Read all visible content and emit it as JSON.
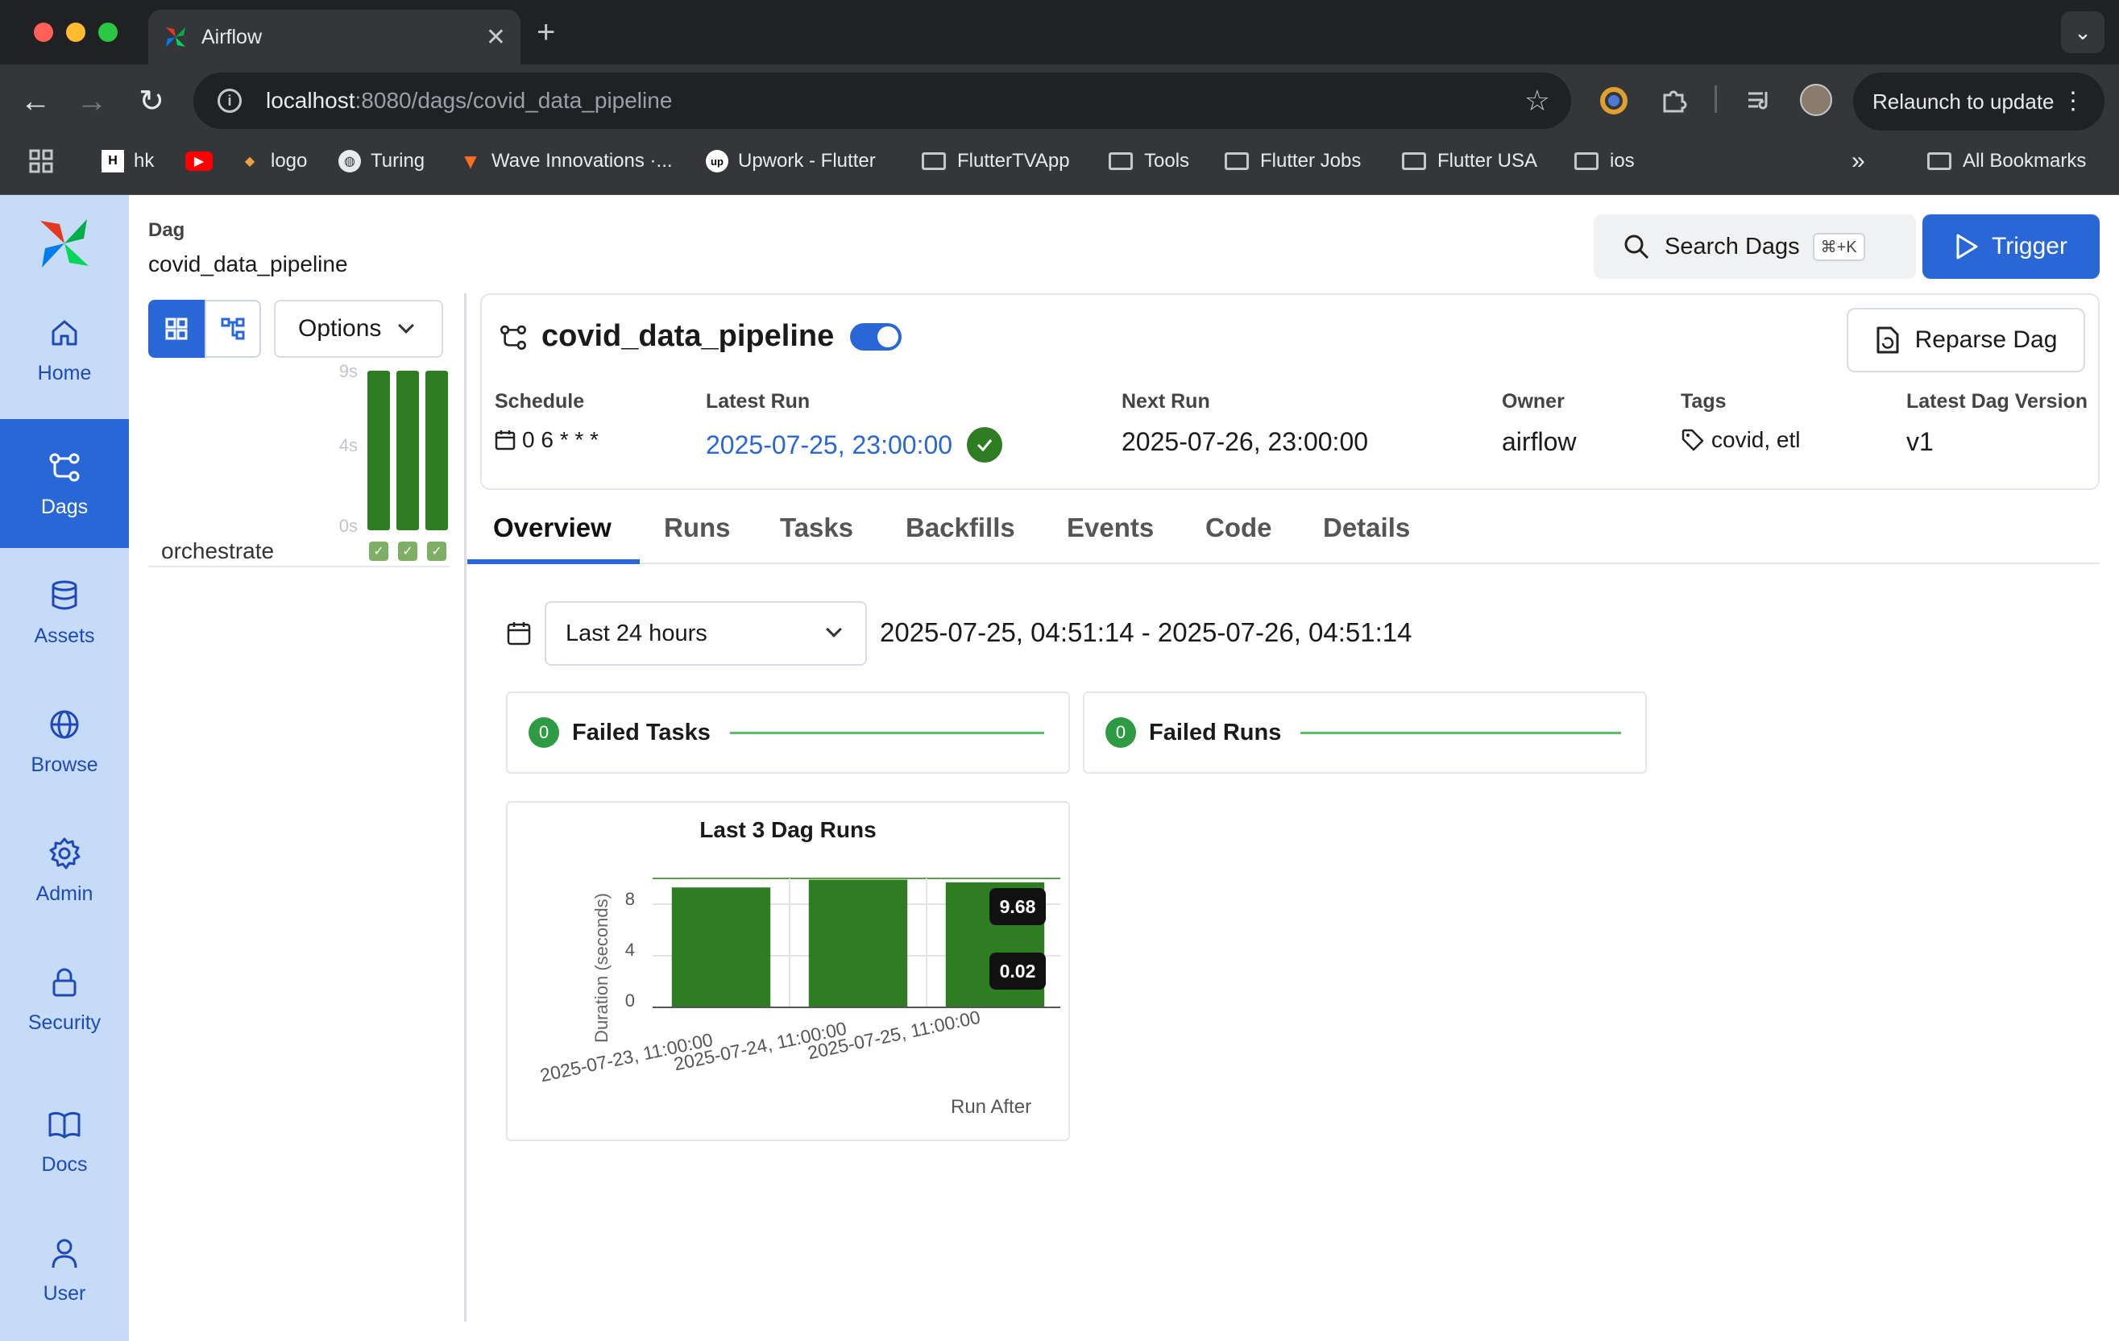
{
  "browser": {
    "tab_title": "Airflow",
    "url_host": "localhost",
    "url_path": ":8080/dags/covid_data_pipeline",
    "relaunch_label": "Relaunch to update",
    "bookmarks": [
      "hk",
      "logo",
      "Turing",
      "Wave Innovations ·...",
      "Upwork - Flutter",
      "FlutterTVApp",
      "Tools",
      "Flutter Jobs",
      "Flutter USA",
      "ios"
    ],
    "all_bookmarks": "All Bookmarks",
    "overflow": "»"
  },
  "sidebar": {
    "items": [
      {
        "label": "Home",
        "icon": "home-icon"
      },
      {
        "label": "Dags",
        "icon": "dags-icon"
      },
      {
        "label": "Assets",
        "icon": "database-icon"
      },
      {
        "label": "Browse",
        "icon": "globe-icon"
      },
      {
        "label": "Admin",
        "icon": "gear-icon"
      },
      {
        "label": "Security",
        "icon": "lock-icon"
      },
      {
        "label": "Docs",
        "icon": "book-icon"
      },
      {
        "label": "User",
        "icon": "user-icon"
      }
    ],
    "active": "Dags"
  },
  "header": {
    "breadcrumb_label": "Dag",
    "breadcrumb_value": "covid_data_pipeline",
    "search_label": "Search Dags",
    "search_shortcut": "⌘+K",
    "trigger_label": "Trigger"
  },
  "grid": {
    "options_label": "Options",
    "ticks": [
      "9s",
      "4s",
      "0s"
    ],
    "task_name": "orchestrate",
    "bar_fractions": [
      1.0,
      1.0,
      1.0
    ]
  },
  "dag": {
    "title": "covid_data_pipeline",
    "paused": false,
    "reparse_label": "Reparse Dag",
    "fields": {
      "schedule_label": "Schedule",
      "schedule_value": "0 6 * * *",
      "latest_run_label": "Latest Run",
      "latest_run_value": "2025-07-25, 23:00:00",
      "next_run_label": "Next Run",
      "next_run_value": "2025-07-26, 23:00:00",
      "owner_label": "Owner",
      "owner_value": "airflow",
      "tags_label": "Tags",
      "tags_value": "covid, etl",
      "version_label": "Latest Dag Version",
      "version_value": "v1"
    }
  },
  "tabs": [
    "Overview",
    "Runs",
    "Tasks",
    "Backfills",
    "Events",
    "Code",
    "Details"
  ],
  "overview": {
    "range_select": "Last 24 hours",
    "range_text": "2025-07-25, 04:51:14 - 2025-07-26, 04:51:14",
    "failed_tasks": {
      "count": "0",
      "label": "Failed Tasks"
    },
    "failed_runs": {
      "count": "0",
      "label": "Failed Runs"
    }
  },
  "colors": {
    "accent": "#2a67d6",
    "success": "#2e7d22",
    "sidebar": "#c6dbf7"
  },
  "chart_data": {
    "type": "bar",
    "title": "Last 3 Dag Runs",
    "xlabel": "Run After",
    "ylabel": "Duration (seconds)",
    "categories": [
      "2025-07-23, 11:00:00",
      "2025-07-24, 11:00:00",
      "2025-07-25, 11:00:00"
    ],
    "values": [
      9.3,
      9.9,
      9.7
    ],
    "ylim": [
      0,
      10
    ],
    "yticks": [
      "8",
      "4",
      "0"
    ],
    "tooltip": [
      "9.68",
      "0.02"
    ],
    "grid": true
  }
}
